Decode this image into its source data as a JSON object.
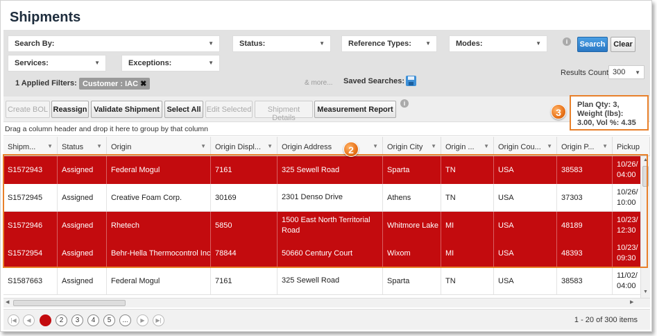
{
  "page": {
    "title": "Shipments"
  },
  "filters": {
    "search_by": "Search By:",
    "status": "Status:",
    "reference_types": "Reference Types:",
    "modes": "Modes:",
    "services": "Services:",
    "exceptions": "Exceptions:",
    "search_button": "Search",
    "clear_button": "Clear",
    "results_count_label": "Results Count:",
    "results_count_value": "300",
    "applied_filters_label": "1 Applied Filters:",
    "applied_filter_chip": "Customer : IAC",
    "more_link": "& more...",
    "saved_searches_label": "Saved Searches:"
  },
  "toolbar": {
    "create_bol": "Create BOL",
    "reassign": "Reassign",
    "validate_shipment": "Validate Shipment",
    "select_all": "Select All",
    "edit_selected": "Edit Selected",
    "shipment_details": "Shipment Details",
    "measurement_report": "Measurement Report",
    "plan_summary": "Plan Qty: 3, Weight (lbs): 3.00, Vol %: 4.35"
  },
  "grid": {
    "group_hint": "Drag a column header and drop it here to group by that column",
    "columns": [
      "Shipm...",
      "Status",
      "Origin",
      "Origin Displ...",
      "Origin Address",
      "Origin City",
      "Origin ...",
      "Origin Cou...",
      "Origin P...",
      "Pickup"
    ],
    "rows": [
      {
        "id": "S1572943",
        "status": "Assigned",
        "origin": "Federal Mogul",
        "display": "7161",
        "address": "325 Sewell Road",
        "city": "Sparta",
        "state": "TN",
        "country": "USA",
        "postal": "38583",
        "pickup1": "10/26/",
        "pickup2": "04:00",
        "selected": true
      },
      {
        "id": "S1572945",
        "status": "Assigned",
        "origin": "Creative Foam Corp.",
        "display": "30169",
        "address": "2301 Denso Drive",
        "city": "Athens",
        "state": "TN",
        "country": "USA",
        "postal": "37303",
        "pickup1": "10/26/",
        "pickup2": "10:00",
        "selected": false
      },
      {
        "id": "S1572946",
        "status": "Assigned",
        "origin": "Rhetech",
        "display": "5850",
        "address": "1500 East North Territorial Road",
        "city": "Whitmore Lake",
        "state": "MI",
        "country": "USA",
        "postal": "48189",
        "pickup1": "10/23/",
        "pickup2": "12:30",
        "selected": true
      },
      {
        "id": "S1572954",
        "status": "Assigned",
        "origin": "Behr-Hella Thermocontrol Inc",
        "display": "78844",
        "address": "50660 Century Court",
        "city": "Wixom",
        "state": "MI",
        "country": "USA",
        "postal": "48393",
        "pickup1": "10/23/",
        "pickup2": "09:30",
        "selected": true
      },
      {
        "id": "S1587663",
        "status": "Assigned",
        "origin": "Federal Mogul",
        "display": "7161",
        "address": "325 Sewell Road",
        "city": "Sparta",
        "state": "TN",
        "country": "USA",
        "postal": "38583",
        "pickup1": "11/02/",
        "pickup2": "04:00",
        "selected": false
      }
    ]
  },
  "pager": {
    "pages": [
      "1",
      "2",
      "3",
      "4",
      "5",
      "..."
    ],
    "current": "1",
    "summary": "1 - 20 of 300 items"
  },
  "callouts": {
    "two": "2",
    "three": "3"
  },
  "colors": {
    "selected_row": "#c30b0e",
    "accent_button": "#3a8fd6",
    "callout": "#e8802a"
  }
}
